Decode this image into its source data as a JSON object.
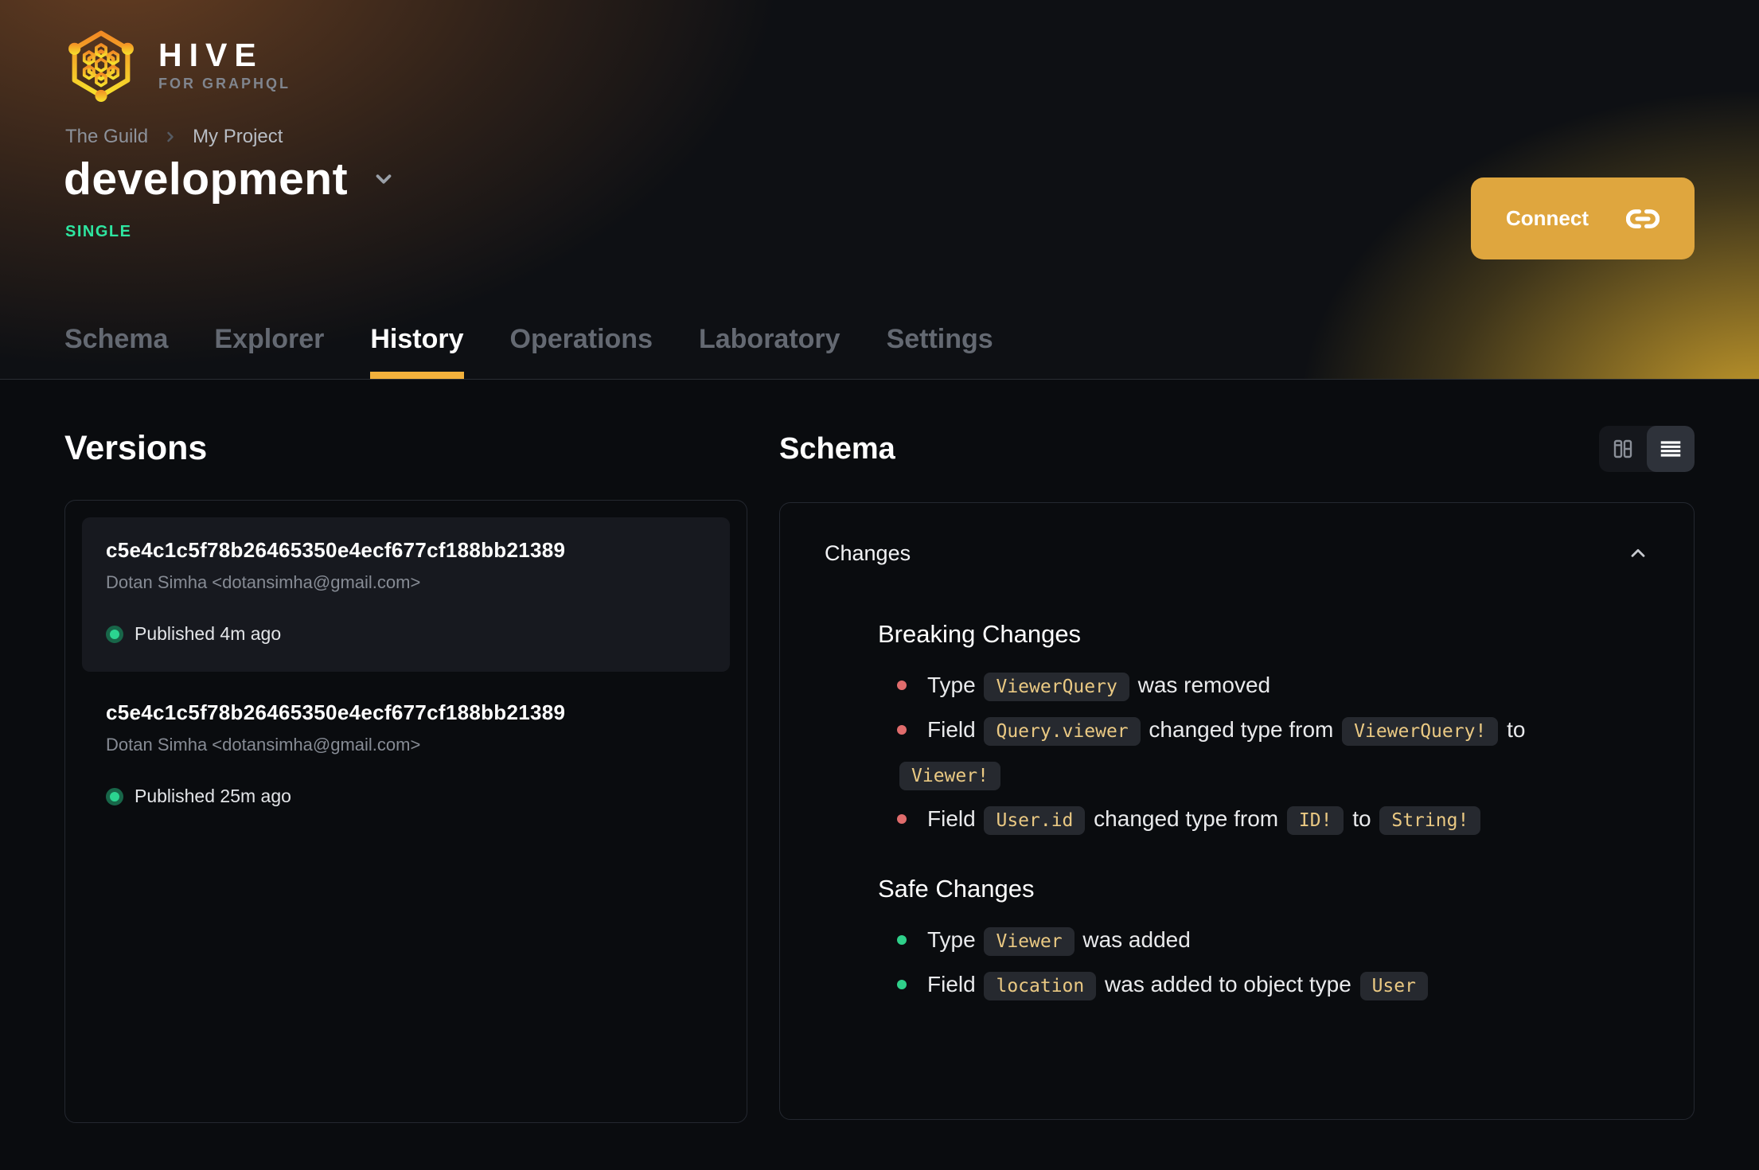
{
  "colors": {
    "accent_amber": "#f2b13c",
    "connect_button": "#dfa63e",
    "badge_green": "#2ee5a0",
    "published_dot": "#2bd490",
    "breaking_bullet": "#e06c6c",
    "safe_bullet": "#2fd08a",
    "code_text": "#eac983",
    "code_bg": "#26292f",
    "panel_border": "#242830",
    "page_bg": "#0a0c0f"
  },
  "logo": {
    "title": "HIVE",
    "subtitle": "FOR GRAPHQL"
  },
  "breadcrumb": {
    "items": [
      {
        "label": "The Guild"
      },
      {
        "label": "My Project"
      }
    ]
  },
  "target": {
    "name": "development",
    "badge": "SINGLE"
  },
  "connect": {
    "label": "Connect"
  },
  "tabs": {
    "items": [
      "Schema",
      "Explorer",
      "History",
      "Operations",
      "Laboratory",
      "Settings"
    ],
    "active": "History"
  },
  "versions": {
    "title": "Versions",
    "items": [
      {
        "hash": "c5e4c1c5f78b26465350e4ecf677cf188bb21389",
        "author": "Dotan Simha <dotansimha@gmail.com>",
        "status": "Published 4m ago",
        "selected": true
      },
      {
        "hash": "c5e4c1c5f78b26465350e4ecf677cf188bb21389",
        "author": "Dotan Simha <dotansimha@gmail.com>",
        "status": "Published 25m ago",
        "selected": false
      }
    ]
  },
  "schema": {
    "title": "Schema",
    "views": [
      {
        "name": "columns-view"
      },
      {
        "name": "list-view"
      }
    ],
    "active_view": "list-view"
  },
  "changes": {
    "label": "Changes",
    "breaking": {
      "title": "Breaking Changes",
      "items": [
        [
          {
            "type": "text",
            "value": "Type "
          },
          {
            "type": "code",
            "value": "ViewerQuery"
          },
          {
            "type": "text",
            "value": " was removed"
          }
        ],
        [
          {
            "type": "text",
            "value": "Field "
          },
          {
            "type": "code",
            "value": "Query.viewer"
          },
          {
            "type": "text",
            "value": " changed type from "
          },
          {
            "type": "code",
            "value": "ViewerQuery!"
          },
          {
            "type": "text",
            "value": " to "
          },
          {
            "type": "code",
            "value": "Viewer!"
          }
        ],
        [
          {
            "type": "text",
            "value": "Field "
          },
          {
            "type": "code",
            "value": "User.id"
          },
          {
            "type": "text",
            "value": " changed type from "
          },
          {
            "type": "code",
            "value": "ID!"
          },
          {
            "type": "text",
            "value": " to "
          },
          {
            "type": "code",
            "value": "String!"
          }
        ]
      ]
    },
    "safe": {
      "title": "Safe Changes",
      "items": [
        [
          {
            "type": "text",
            "value": "Type "
          },
          {
            "type": "code",
            "value": "Viewer"
          },
          {
            "type": "text",
            "value": " was added"
          }
        ],
        [
          {
            "type": "text",
            "value": "Field "
          },
          {
            "type": "code",
            "value": "location"
          },
          {
            "type": "text",
            "value": " was added to object type "
          },
          {
            "type": "code",
            "value": "User"
          }
        ]
      ]
    }
  }
}
